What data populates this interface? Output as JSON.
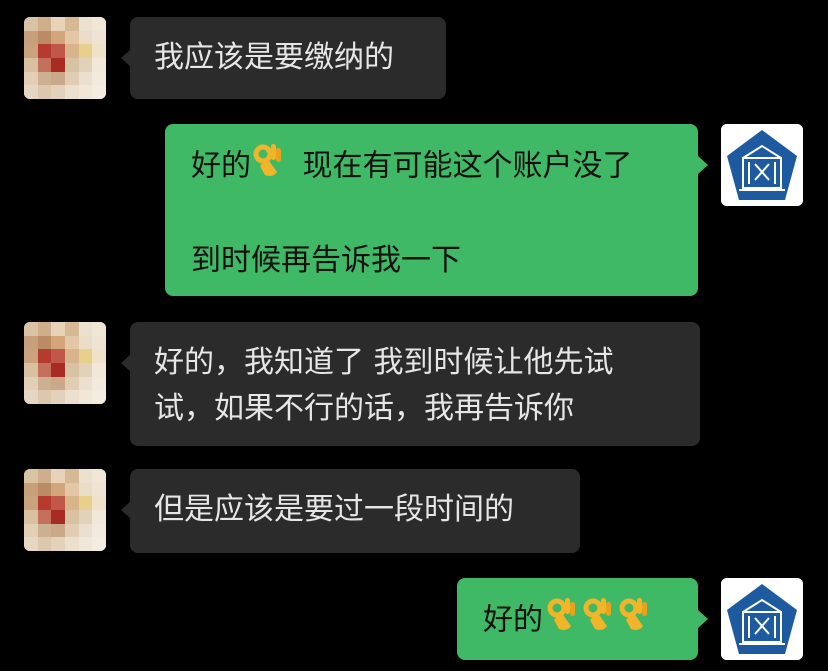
{
  "chat": {
    "messages": [
      {
        "side": "left",
        "lines": [
          "我应该是要缴纳的"
        ]
      },
      {
        "side": "right",
        "lines": [
          "好的",
          "现在有可能这个账户没了",
          "",
          "到时候再告诉我一下"
        ],
        "emoji": "ok-hand-emoji"
      },
      {
        "side": "left",
        "lines": [
          "好的，我知道了 我到时候让他先试",
          "试，如果不行的话，我再告诉你"
        ]
      },
      {
        "side": "left",
        "lines": [
          "但是应该是要过一段时间的"
        ]
      },
      {
        "side": "right",
        "lines": [
          "好的"
        ],
        "emoji": "ok-hand-emoji x3"
      }
    ]
  },
  "colors": {
    "background": "#000000",
    "incoming_bubble": "#2b2b2b",
    "outgoing_bubble": "#3fb965",
    "incoming_text": "#e6e6e6",
    "outgoing_text": "#111111",
    "self_avatar_blue": "#1e5aa0"
  }
}
